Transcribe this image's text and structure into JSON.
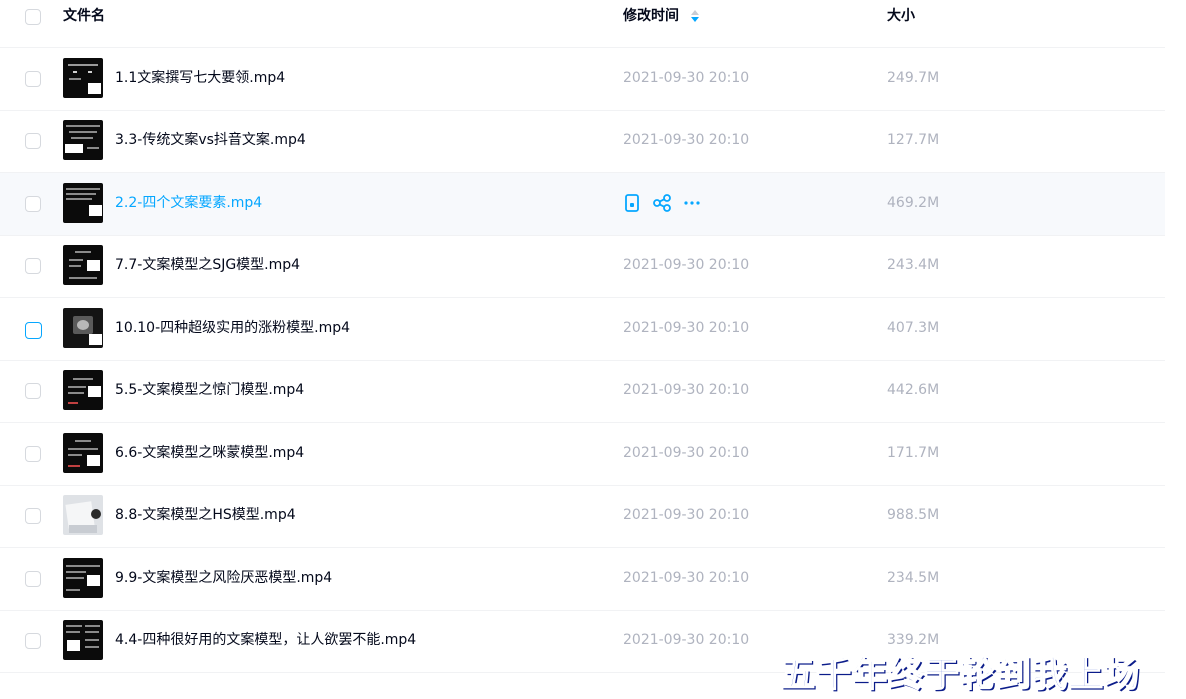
{
  "header": {
    "name_label": "文件名",
    "time_label": "修改时间",
    "size_label": "大小"
  },
  "rows": [
    {
      "name": "1.1文案撰写七大要领.mp4",
      "time": "2021-09-30 20:10",
      "size": "249.7M"
    },
    {
      "name": "3.3-传统文案vs抖音文案.mp4",
      "time": "2021-09-30 20:10",
      "size": "127.7M"
    },
    {
      "name": "2.2-四个文案要素.mp4",
      "time": "",
      "size": "469.2M",
      "hovered": true
    },
    {
      "name": "7.7-文案模型之SJG模型.mp4",
      "time": "2021-09-30 20:10",
      "size": "243.4M"
    },
    {
      "name": "10.10-四种超级实用的涨粉模型.mp4",
      "time": "2021-09-30 20:10",
      "size": "407.3M"
    },
    {
      "name": "5.5-文案模型之惊门模型.mp4",
      "time": "2021-09-30 20:10",
      "size": "442.6M"
    },
    {
      "name": "6.6-文案模型之咪蒙模型.mp4",
      "time": "2021-09-30 20:10",
      "size": "171.7M"
    },
    {
      "name": "8.8-文案模型之HS模型.mp4",
      "time": "2021-09-30 20:10",
      "size": "988.5M"
    },
    {
      "name": "9.9-文案模型之风险厌恶模型.mp4",
      "time": "2021-09-30 20:10",
      "size": "234.5M"
    },
    {
      "name": "4.4-四种很好用的文案模型，让人欲罢不能.mp4",
      "time": "2021-09-30 20:10",
      "size": "339.2M"
    }
  ],
  "hover_actions": [
    "phone-icon",
    "share-icon",
    "more-icon"
  ],
  "watermark": "五千年终于轮到我上场",
  "colors": {
    "accent": "#06a7ff",
    "text": "#03081a",
    "muted": "#afb3bf",
    "hover_bg": "#f7f9fc",
    "watermark": "#1a3cc8"
  }
}
